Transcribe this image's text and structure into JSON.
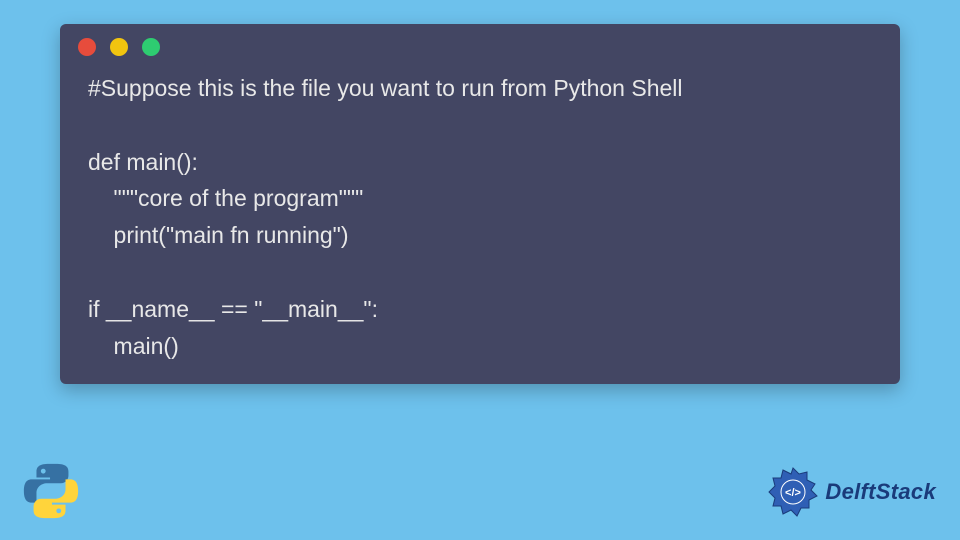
{
  "code": {
    "lines": "#Suppose this is the file you want to run from Python Shell\n\ndef main():\n    \"\"\"core of the program\"\"\"\n    print(\"main fn running\")\n\nif __name__ == \"__main__\":\n    main()"
  },
  "brand": {
    "name": "DelftStack"
  },
  "colors": {
    "background": "#6dc1ec",
    "editor_bg": "#434663",
    "text": "#e8e8e8",
    "dot_red": "#e74c3c",
    "dot_yellow": "#f1c40f",
    "dot_green": "#2ecc71",
    "brand_blue": "#1a3b7a"
  }
}
